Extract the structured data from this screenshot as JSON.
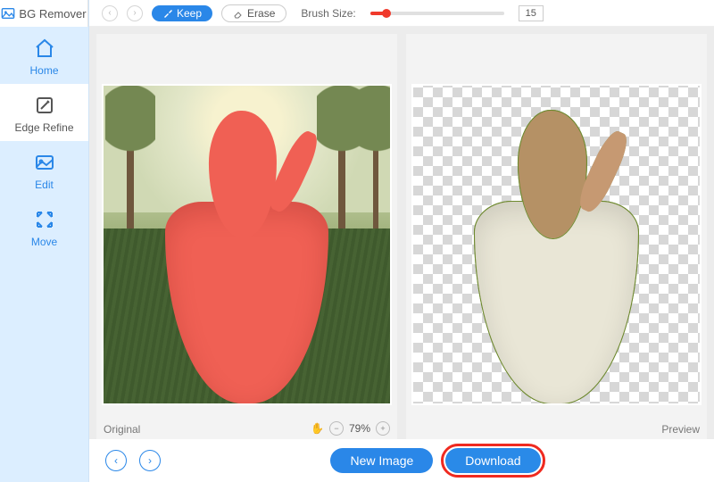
{
  "app": {
    "title": "BG Remover"
  },
  "sidebar": {
    "items": [
      {
        "label": "Home",
        "icon": "home-icon"
      },
      {
        "label": "Edge Refine",
        "icon": "edge-refine-icon"
      },
      {
        "label": "Edit",
        "icon": "edit-icon"
      },
      {
        "label": "Move",
        "icon": "move-icon"
      }
    ]
  },
  "toolbar": {
    "keep": "Keep",
    "erase": "Erase",
    "brush_label": "Brush Size:",
    "brush_value": "15"
  },
  "panels": {
    "left_caption": "Original",
    "right_caption": "Preview",
    "zoom_pct": "79%"
  },
  "footer": {
    "new_image": "New Image",
    "download": "Download"
  },
  "colors": {
    "accent": "#2a87e8",
    "highlight": "#ef2a20",
    "mask": "#f06054"
  }
}
